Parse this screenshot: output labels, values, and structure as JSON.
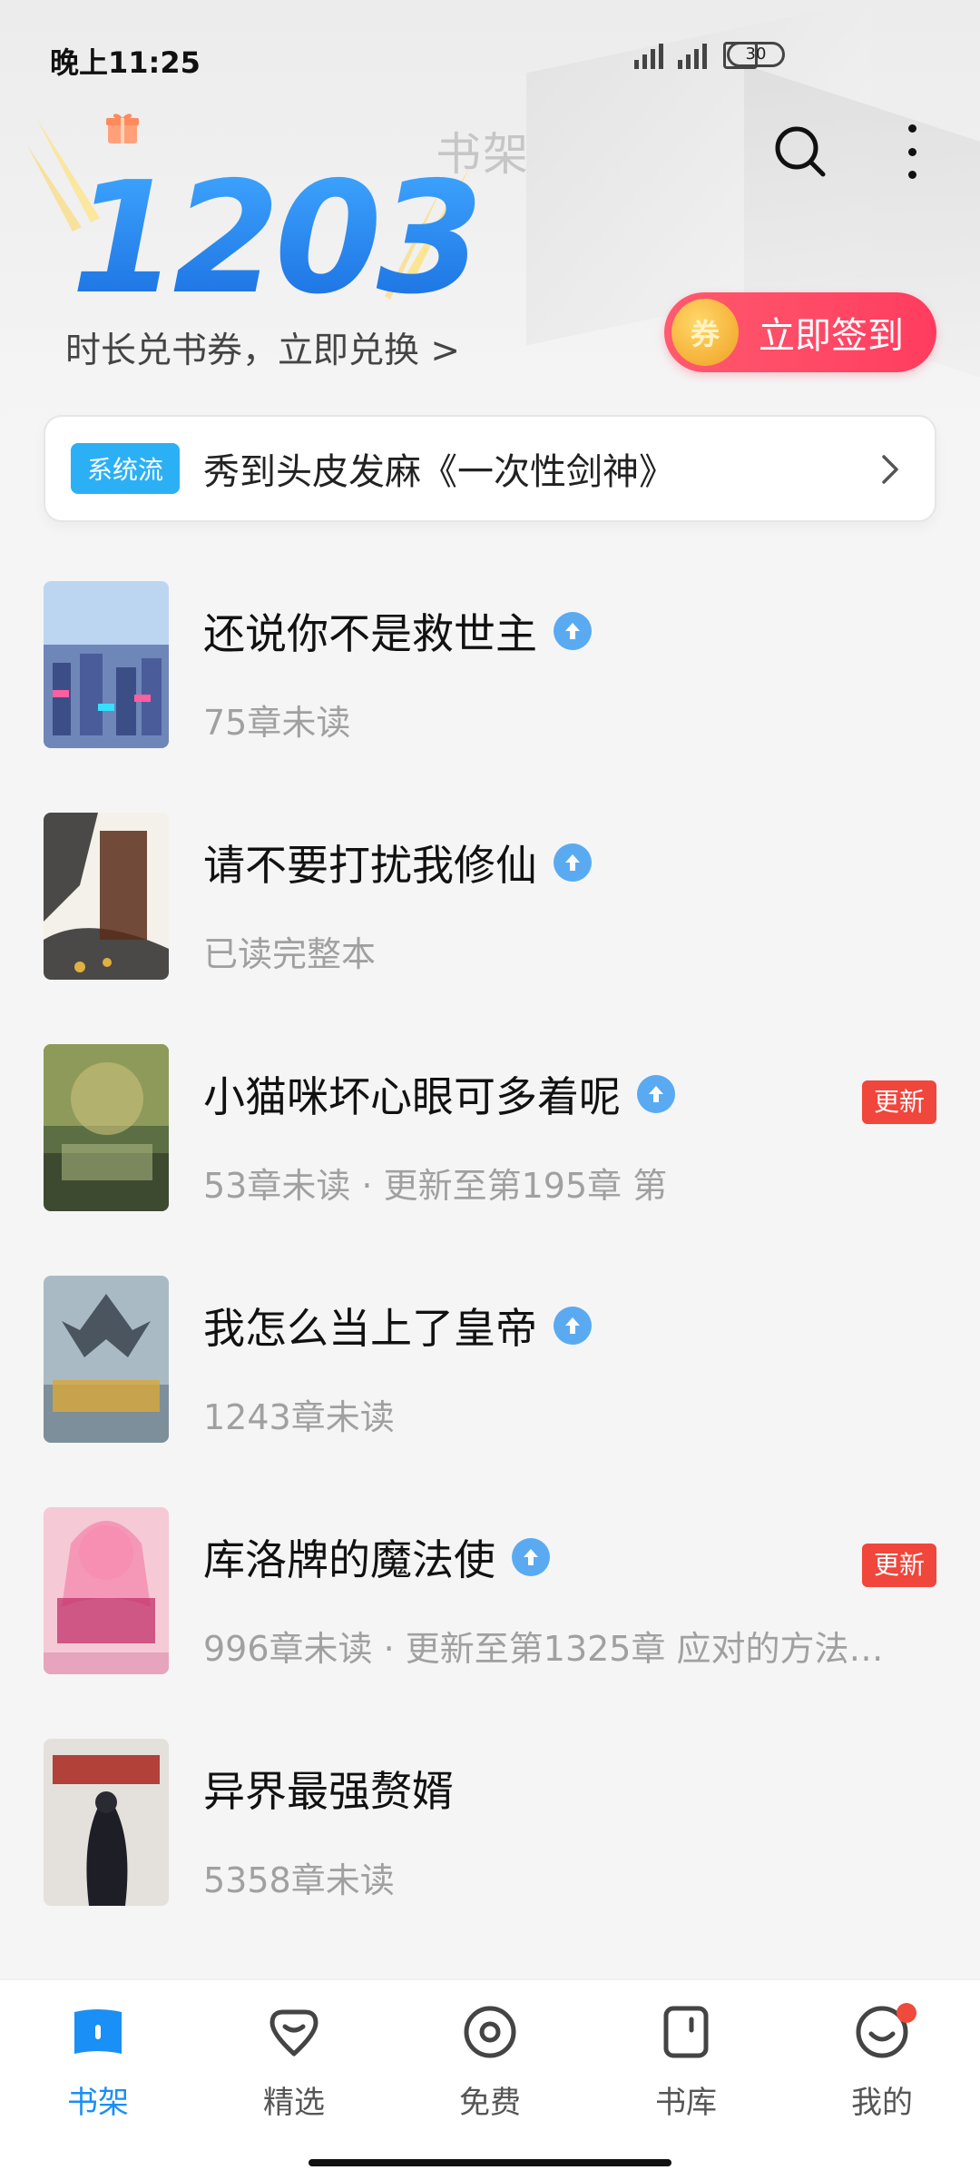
{
  "status_bar": {
    "time": "晚上11:25",
    "battery": "30"
  },
  "header": {
    "title": "书架",
    "points": "1203",
    "exchange_link": "时长兑书券，立即兑换 >",
    "checkin_coin": "券",
    "checkin_label": "立即签到"
  },
  "banner": {
    "tag": "系统流",
    "text": "秀到头皮发麻《一次性剑神》"
  },
  "books": [
    {
      "title": "还说你不是救世主",
      "status": "75章未读",
      "badge": "",
      "cover_color": "#8fb6e6"
    },
    {
      "title": "请不要打扰我修仙",
      "status": "已读完整本",
      "badge": "",
      "cover_color": "#f2efe7"
    },
    {
      "title": "小猫咪坏心眼可多着呢",
      "status": "53章未读 · 更新至第195章 第",
      "badge": "更新",
      "cover_color": "#6a7f4e"
    },
    {
      "title": "我怎么当上了皇帝",
      "status": "1243章未读",
      "badge": "",
      "cover_color": "#9fb1bd"
    },
    {
      "title": "库洛牌的魔法使",
      "status": "996章未读 · 更新至第1325章 应对的方法…",
      "badge": "更新",
      "cover_color": "#f2b7c9"
    },
    {
      "title": "异界最强赘婿",
      "status": "5358章未读",
      "badge": "",
      "cover_color": "#d9d6d2"
    }
  ],
  "tabs": [
    {
      "label": "书架",
      "icon": "bookshelf-icon",
      "active": true
    },
    {
      "label": "精选",
      "icon": "featured-icon",
      "active": false
    },
    {
      "label": "免费",
      "icon": "free-icon",
      "active": false
    },
    {
      "label": "书库",
      "icon": "library-icon",
      "active": false
    },
    {
      "label": "我的",
      "icon": "profile-icon",
      "active": false
    }
  ],
  "colors": {
    "accent": "#1a8ff5",
    "checkin": "#ff4a64",
    "badge": "#f0463c",
    "tag": "#2bb0f5"
  }
}
